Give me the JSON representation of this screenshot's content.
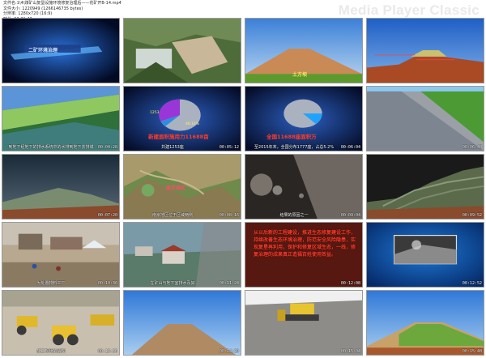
{
  "header": {
    "info_lines": [
      "文件名:1\\4\\煤矿山复垦设施环境修复治理后——花矿开B-14.mp4",
      "文件大小: 1220949 (1266146735 bytes)",
      "分辨率: 1280x720 (16:9)",
      "时长: 00:21:43"
    ],
    "brand": "Media Player Classic"
  },
  "thumbnails": [
    {
      "timestamp": "",
      "caption": "",
      "label": "二矿环境治理"
    },
    {
      "timestamp": "",
      "caption": "",
      "label": ""
    },
    {
      "timestamp": "",
      "caption": "",
      "label": "土方坝"
    },
    {
      "timestamp": "",
      "caption": "",
      "label": ""
    },
    {
      "timestamp": "00:04:28",
      "caption": "到地下经地下的排水系统中的水排到地下去排城",
      "label": ""
    },
    {
      "timestamp": "00:05:12",
      "caption": "共建1253座",
      "label": "新建面积施用力11688亩",
      "pie_labels": [
        "1253",
        "46.14%"
      ]
    },
    {
      "timestamp": "00:06:04",
      "caption": "至2015年末，全国分布1777座，占总5.2%",
      "label": "全国11688座面积万",
      "pie_labels": []
    },
    {
      "timestamp": "00:06:48",
      "caption": "",
      "label": ""
    },
    {
      "timestamp": "00:07:20",
      "caption": "",
      "label": ""
    },
    {
      "timestamp": "00:08:16",
      "caption": "南京地区位于区域两侧",
      "label": "南京城区",
      "pie_labels": []
    },
    {
      "timestamp": "00:09:04",
      "caption": "结果的原因之一",
      "label": ""
    },
    {
      "timestamp": "00:09:52",
      "caption": "",
      "label": ""
    },
    {
      "timestamp": "00:10:36",
      "caption": "为处置物料工厂",
      "label": ""
    },
    {
      "timestamp": "00:11:24",
      "caption": "在矿山与地下室排水及其",
      "label": ""
    },
    {
      "timestamp": "00:12:08",
      "caption": "",
      "label": "",
      "red_text": "从以后新的工程建设，推进生态修复建设工作，持续改善生态环境治理，防范安全风险隐患，实现复垦再利用，保护和修复区域生态，一线，修复治理的成果真正造福百姓使用效益。"
    },
    {
      "timestamp": "00:12:52",
      "caption": "",
      "label": ""
    },
    {
      "timestamp": "00:13:36",
      "caption": "施工现场的清理",
      "label": ""
    },
    {
      "timestamp": "00:14:20",
      "caption": "",
      "label": ""
    },
    {
      "timestamp": "00:15:04",
      "caption": "",
      "label": ""
    },
    {
      "timestamp": "00:15:48",
      "caption": "",
      "label": ""
    }
  ]
}
